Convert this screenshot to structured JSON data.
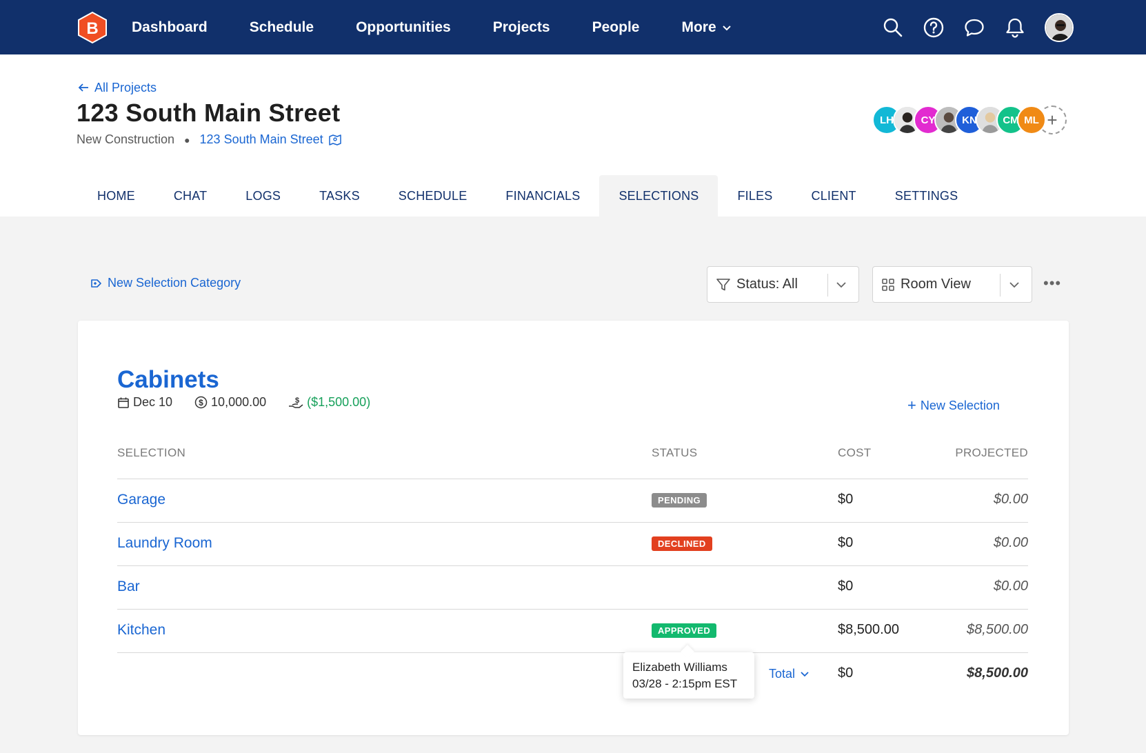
{
  "nav": {
    "links": [
      "Dashboard",
      "Schedule",
      "Opportunities",
      "Projects",
      "People",
      "More"
    ],
    "icons": [
      "search-icon",
      "help-icon",
      "chat-icon",
      "bell-icon"
    ],
    "logo_letter": "B",
    "brand_color": "#f04e23",
    "bg_color": "#11306b"
  },
  "header": {
    "back_label": "All Projects",
    "title": "123 South Main Street",
    "project_type": "New Construction",
    "address": "123 South Main Street",
    "team": [
      {
        "initials": "LH",
        "color": "#12b8d6"
      },
      {
        "initials": "",
        "color": "#6b6b6b",
        "photo": true
      },
      {
        "initials": "CY",
        "color": "#e22bd0"
      },
      {
        "initials": "",
        "color": "#8a8a8a",
        "photo": true
      },
      {
        "initials": "KN",
        "color": "#1f5fd9"
      },
      {
        "initials": "",
        "color": "#b8b8b8",
        "photo": true
      },
      {
        "initials": "CM",
        "color": "#13c28a"
      },
      {
        "initials": "ML",
        "color": "#f08a15"
      }
    ]
  },
  "tabs": [
    "HOME",
    "CHAT",
    "LOGS",
    "TASKS",
    "SCHEDULE",
    "FINANCIALS",
    "SELECTIONS",
    "FILES",
    "CLIENT",
    "SETTINGS"
  ],
  "active_tab": "SELECTIONS",
  "toolbar": {
    "new_category": "New Selection Category",
    "status_filter": "Status: All",
    "view_mode": "Room View"
  },
  "category": {
    "title": "Cabinets",
    "date": "Dec 10",
    "budget": "10,000.00",
    "variance": "($1,500.00)",
    "new_selection": "New Selection",
    "columns": {
      "selection": "SELECTION",
      "status": "STATUS",
      "cost": "COST",
      "projected": "PROJECTED"
    },
    "rows": [
      {
        "name": "Garage",
        "status": "PENDING",
        "status_color": "#8c8c8c",
        "cost": "$0",
        "projected": "$0.00"
      },
      {
        "name": "Laundry Room",
        "status": "DECLINED",
        "status_color": "#e2401f",
        "cost": "$0",
        "projected": "$0.00"
      },
      {
        "name": "Bar",
        "status": "",
        "status_color": "",
        "cost": "$0",
        "projected": "$0.00"
      },
      {
        "name": "Kitchen",
        "status": "APPROVED",
        "status_color": "#13b96e",
        "cost": "$8,500.00",
        "projected": "$8,500.00"
      }
    ],
    "total": {
      "label": "Total",
      "cost": "$0",
      "projected": "$8,500.00"
    }
  },
  "tooltip": {
    "name": "Elizabeth Williams",
    "time": "03/28 - 2:15pm EST"
  }
}
